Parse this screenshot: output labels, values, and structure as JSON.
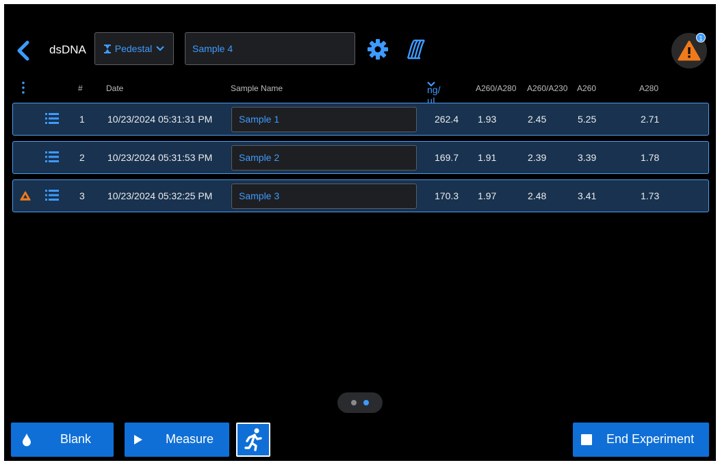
{
  "header": {
    "title": "dsDNA",
    "mode_label": "Pedestal",
    "sample_name_value": "Sample 4",
    "alert_count": "1"
  },
  "columns": {
    "num": "#",
    "date": "Date",
    "sample_name": "Sample Name",
    "concentration": "ng/µL",
    "a260_280": "A260/A280",
    "a260_230": "A260/A230",
    "a260": "A260",
    "a280": "A280"
  },
  "rows": [
    {
      "num": "1",
      "date": "10/23/2024 05:31:31 PM",
      "name": "Sample 1",
      "ng": "262.4",
      "a260_280": "1.93",
      "a260_230": "2.45",
      "a260": "5.25",
      "a280": "2.71",
      "warning": false
    },
    {
      "num": "2",
      "date": "10/23/2024 05:31:53 PM",
      "name": "Sample 2",
      "ng": "169.7",
      "a260_280": "1.91",
      "a260_230": "2.39",
      "a260": "3.39",
      "a280": "1.78",
      "warning": false
    },
    {
      "num": "3",
      "date": "10/23/2024 05:32:25 PM",
      "name": "Sample 3",
      "ng": "170.3",
      "a260_280": "1.97",
      "a260_230": "2.48",
      "a260": "3.41",
      "a280": "1.73",
      "warning": true
    }
  ],
  "pager": {
    "pages": 2,
    "active_page": 2
  },
  "footer": {
    "blank_label": "Blank",
    "measure_label": "Measure",
    "end_label": "End Experiment"
  },
  "icons": {
    "back": "chevron-left-icon",
    "mode": "hourglass-icon",
    "settings": "gear-icon",
    "spectrum": "spectrum-icon",
    "alert": "warning-icon",
    "menu": "kebab-menu-icon",
    "row_details": "list-icon",
    "blank": "droplet-icon",
    "measure": "play-icon",
    "quick_run": "running-person-icon",
    "end": "stop-icon"
  },
  "colors": {
    "accent": "#3d9bff",
    "button": "#0f6fd6",
    "row_bg": "#18324f",
    "row_border": "#4f9bee",
    "warning": "#f07a1a"
  }
}
